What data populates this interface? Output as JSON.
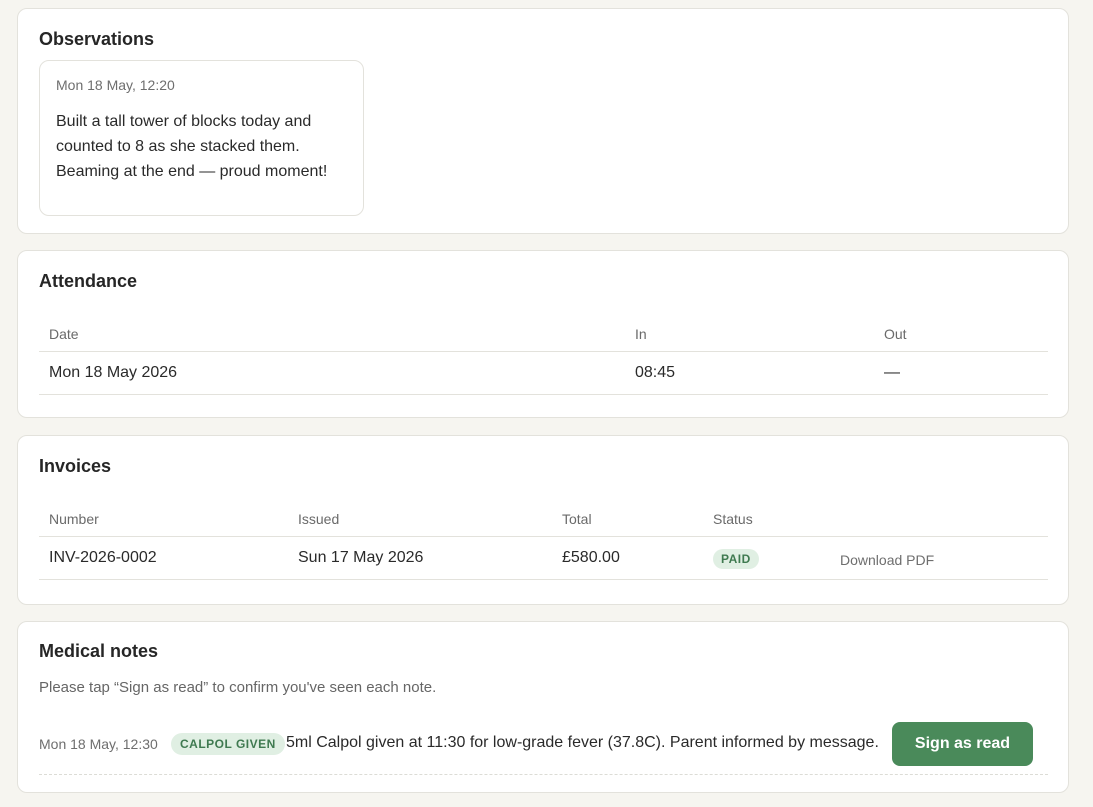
{
  "observations": {
    "title": "Observations",
    "items": [
      {
        "time": "Mon 18 May, 12:20",
        "text": "Built a tall tower of blocks today and counted to 8 as she stacked them. Beaming at the end — proud moment!"
      }
    ]
  },
  "attendance": {
    "title": "Attendance",
    "columns": [
      "Date",
      "In",
      "Out"
    ],
    "rows": [
      {
        "date": "Mon 18 May 2026",
        "in": "08:45",
        "out": "—"
      }
    ]
  },
  "invoices": {
    "title": "Invoices",
    "columns": [
      "Number",
      "Issued",
      "Total",
      "Status"
    ],
    "rows": [
      {
        "number": "INV-2026-0002",
        "issued": "Sun 17 May 2026",
        "total": "£580.00",
        "status": "PAID",
        "action": "Download PDF"
      }
    ]
  },
  "medical": {
    "title": "Medical notes",
    "intro": "Please tap “Sign as read” to confirm you've seen each note.",
    "notes": [
      {
        "time": "Mon 18 May, 12:30",
        "tag": "CALPOL GIVEN",
        "text": "5ml Calpol given at 11:30 for low-grade fever (37.8C). Parent informed by message.",
        "button": "Sign as read"
      }
    ]
  },
  "colors": {
    "accent": "#4a8a5a",
    "badge_bg": "#e0efe3",
    "badge_text": "#3f7a50"
  }
}
